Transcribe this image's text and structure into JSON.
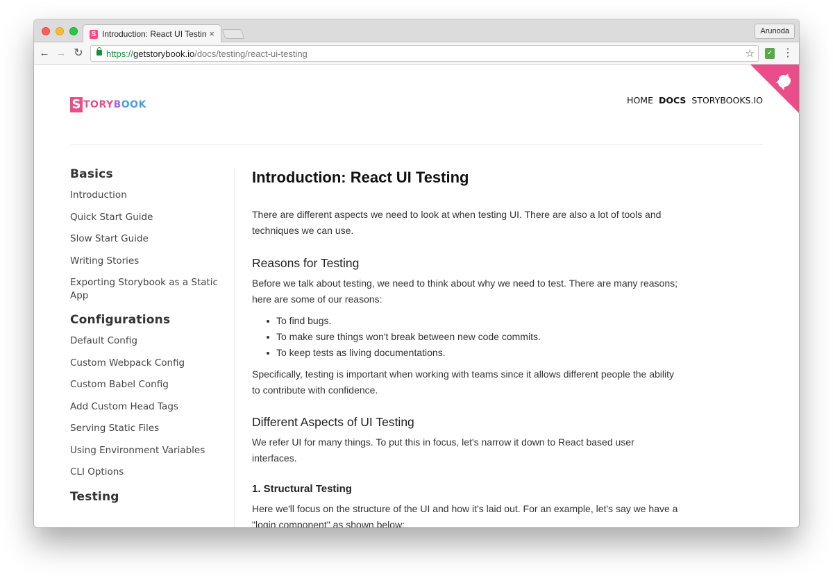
{
  "browser": {
    "tab_title": "Introduction: React UI Testing",
    "tab_favicon_letter": "S",
    "tab_close": "×",
    "profile_name": "Arunoda",
    "url_scheme": "https://",
    "url_host": "getstorybook.io",
    "url_path": "/docs/testing/react-ui-testing"
  },
  "site": {
    "logo_letter": "S",
    "logo_parts": [
      "TORY",
      "B",
      "OOK"
    ],
    "nav": [
      "HOME",
      "DOCS",
      "STORYBOOKS.IO"
    ],
    "nav_active": "DOCS",
    "brand_color": "#e94e8a"
  },
  "sidebar": {
    "sections": [
      {
        "heading": "Basics",
        "items": [
          "Introduction",
          "Quick Start Guide",
          "Slow Start Guide",
          "Writing Stories",
          "Exporting Storybook as a Static App"
        ]
      },
      {
        "heading": "Configurations",
        "items": [
          "Default Config",
          "Custom Webpack Config",
          "Custom Babel Config",
          "Add Custom Head Tags",
          "Serving Static Files",
          "Using Environment Variables",
          "CLI Options"
        ]
      },
      {
        "heading": "Testing",
        "items": []
      }
    ]
  },
  "article": {
    "title": "Introduction: React UI Testing",
    "intro": "There are different aspects we need to look at when testing UI. There are also a lot of tools and techniques we can use.",
    "reasons_heading": "Reasons for Testing",
    "reasons_text": "Before we talk about testing, we need to think about why we need to test. There are many reasons; here are some of our reasons:",
    "reasons_list": [
      "To find bugs.",
      "To make sure things won't break between new code commits.",
      "To keep tests as living documentations."
    ],
    "reasons_summary": "Specifically, testing is important when working with teams since it allows different people the ability to contribute with confidence.",
    "aspects_heading": "Different Aspects of UI Testing",
    "aspects_text": "We refer UI for many things. To put this in focus, let's narrow it down to React based user interfaces.",
    "structural_heading": "1. Structural Testing",
    "structural_text": "Here we'll focus on the structure of the UI and how it's laid out. For an example, let's say we have a \"login component\" as shown below:"
  }
}
